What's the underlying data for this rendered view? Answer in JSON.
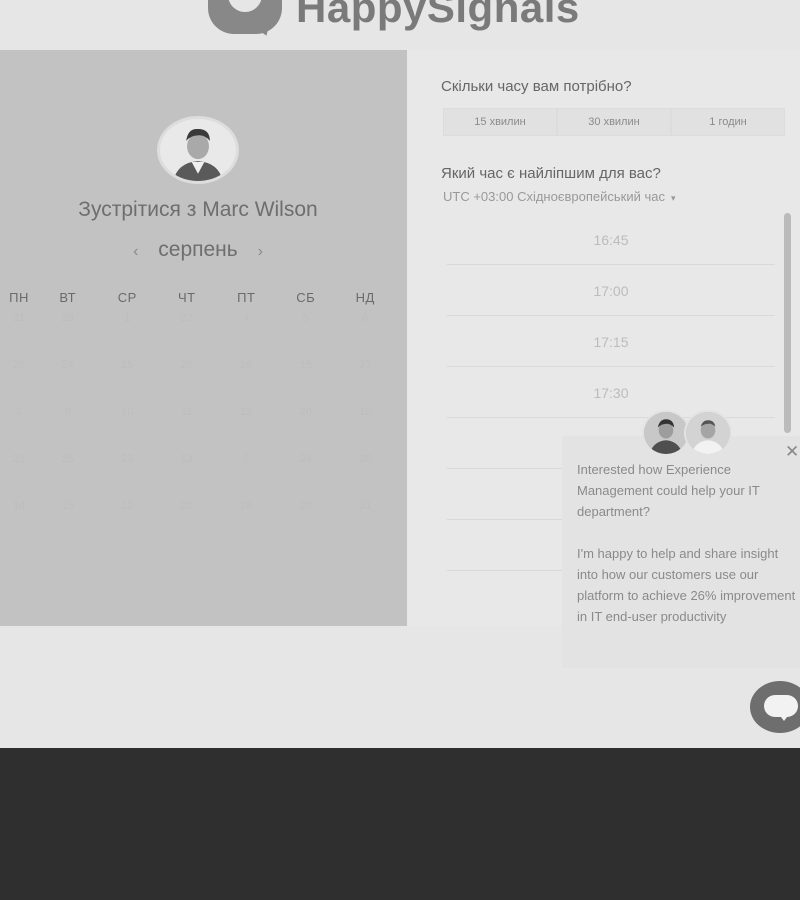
{
  "header": {
    "brand": "HappySignals"
  },
  "scheduler": {
    "title": "Зустрітися з Marc Wilson",
    "month": "серпень",
    "prev_icon": "‹",
    "next_icon": "›",
    "weekdays": [
      "ПН",
      "ВТ",
      "СР",
      "ЧТ",
      "ПТ",
      "СБ",
      "НД"
    ],
    "days": [
      [
        "31",
        "28",
        "1",
        "27",
        "4",
        "5",
        "6"
      ],
      [
        "26",
        "24",
        "25",
        "26",
        "26",
        "15",
        "27"
      ],
      [
        "3",
        "8",
        "10",
        "11",
        "12",
        "20",
        "15"
      ],
      [
        "21",
        "25",
        "23",
        "13",
        "7",
        "24",
        "26"
      ],
      [
        "14",
        "15",
        "12",
        "20",
        "28",
        "29",
        "31"
      ]
    ]
  },
  "duration": {
    "question": "Скільки часу вам потрібно?",
    "options": [
      "15 хвилин",
      "30 хвилин",
      "1 годин"
    ]
  },
  "time": {
    "question": "Який час є найліпшим для вас?",
    "timezone": "UTC +03:00 Східноєвропейський час",
    "caret": "▾",
    "slots": [
      "16:45",
      "17:00",
      "17:15",
      "17:30",
      "",
      "",
      ""
    ]
  },
  "chat_popup": {
    "close": "✕",
    "line1": "Interested how Experience Management could help your IT department?",
    "line2": "I'm happy to help and share insight into how our customers use our platform to achieve 26% improvement in IT end-user productivity"
  },
  "icons": {
    "logo": "speech-bubble-logo-icon",
    "chat": "chat-bubble-icon"
  }
}
